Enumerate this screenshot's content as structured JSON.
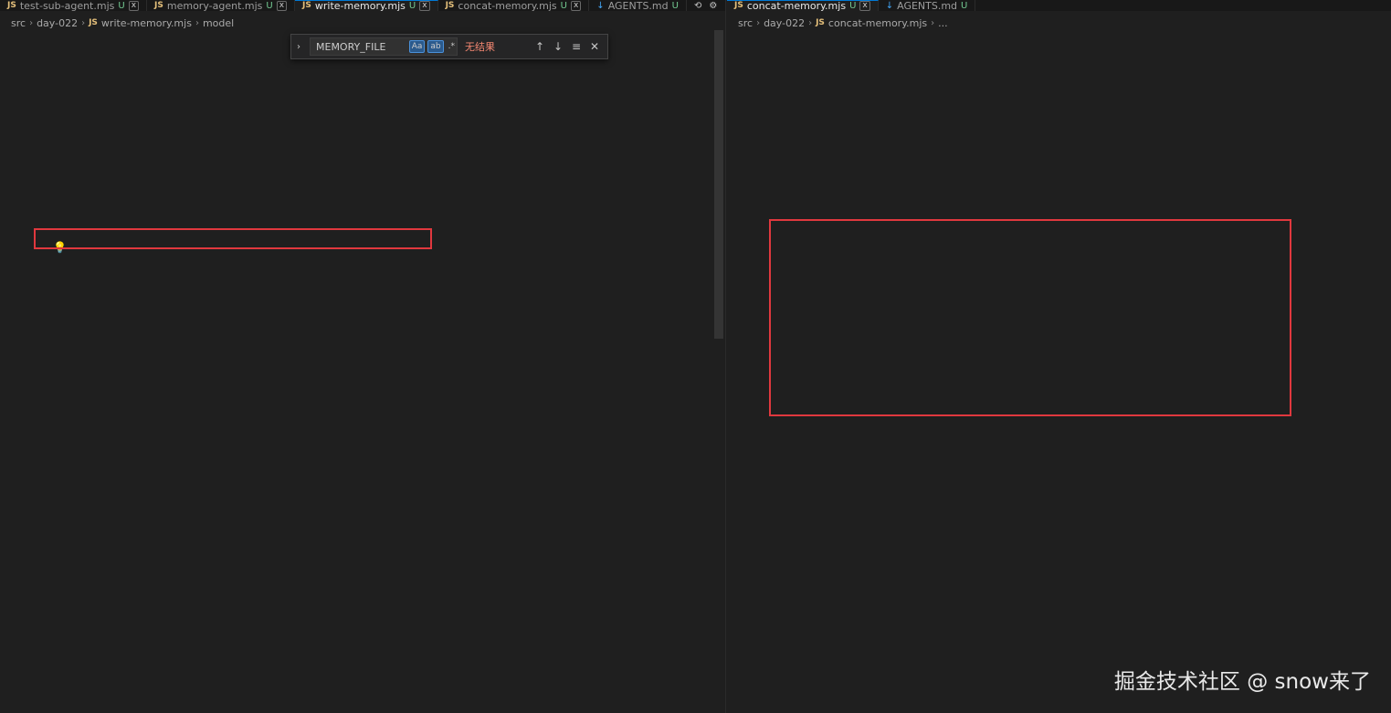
{
  "left": {
    "tabs": [
      {
        "label": "test-sub-agent.mjs",
        "status": "U",
        "type": "js"
      },
      {
        "label": "memory-agent.mjs",
        "status": "U",
        "type": "js"
      },
      {
        "label": "write-memory.mjs",
        "status": "U",
        "type": "js",
        "active": true
      },
      {
        "label": "concat-memory.mjs",
        "status": "U",
        "type": "js"
      },
      {
        "label": "AGENTS.md",
        "status": "U",
        "type": "md"
      }
    ],
    "breadcrumb": [
      "src",
      "day-022",
      "write-memory.mjs",
      "model"
    ],
    "find": {
      "query": "MEMORY_FILE",
      "match_case": "Aa",
      "whole_word": "ab",
      "regex": ".*",
      "result": "无结果"
    }
  },
  "right": {
    "tabs": [
      {
        "label": "concat-memory.mjs",
        "status": "U",
        "type": "js",
        "active": true
      },
      {
        "label": "AGENTS.md",
        "status": "U",
        "type": "md"
      }
    ],
    "breadcrumb": [
      "src",
      "day-022",
      "concat-memory.mjs",
      "..."
    ]
  },
  "icons": {
    "js": "JS",
    "md": "↓",
    "close": "x",
    "chevron": "›",
    "expand": "›",
    "up": "↑",
    "down": "↓",
    "menu": "≡",
    "find_close": "✕",
    "actions": [
      "⟲",
      "⚙",
      "◫",
      "⋯"
    ],
    "lightbulb": "💡"
  },
  "watermark": "掘金技术社区 @ snow来了",
  "colors": {
    "highlight": "#e0383e",
    "keyword": "#569cd6",
    "string": "#ce9178"
  }
}
